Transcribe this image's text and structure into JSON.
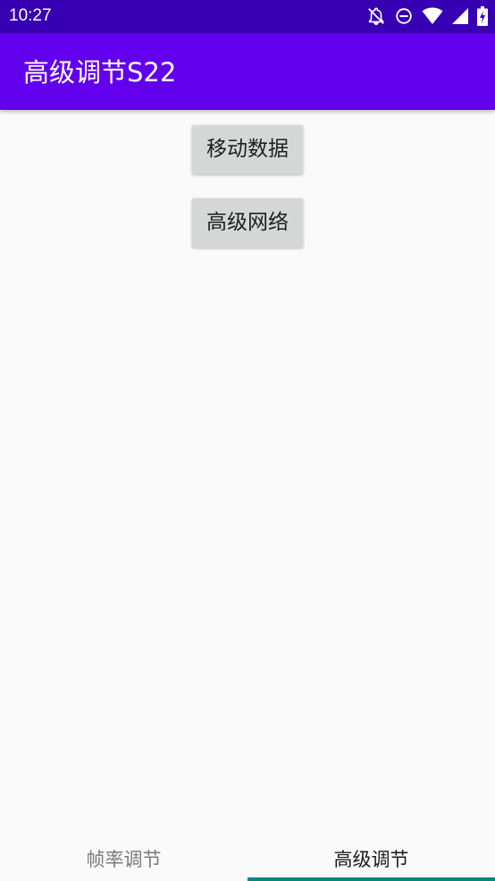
{
  "status_bar": {
    "time": "10:27",
    "icons": [
      "notifications-off-icon",
      "do-not-disturb-icon",
      "wifi-icon",
      "cellular-signal-icon",
      "battery-charging-icon"
    ],
    "background_color": "#3700B3"
  },
  "app_bar": {
    "title": "高级调节S22",
    "background_color": "#6200EE"
  },
  "main": {
    "buttons": [
      {
        "label": "移动数据"
      },
      {
        "label": "高级网络"
      }
    ]
  },
  "bottom_tabs": {
    "tabs": [
      {
        "label": "帧率调节",
        "selected": false
      },
      {
        "label": "高级调节",
        "selected": true
      }
    ],
    "indicator_color": "#018786"
  }
}
